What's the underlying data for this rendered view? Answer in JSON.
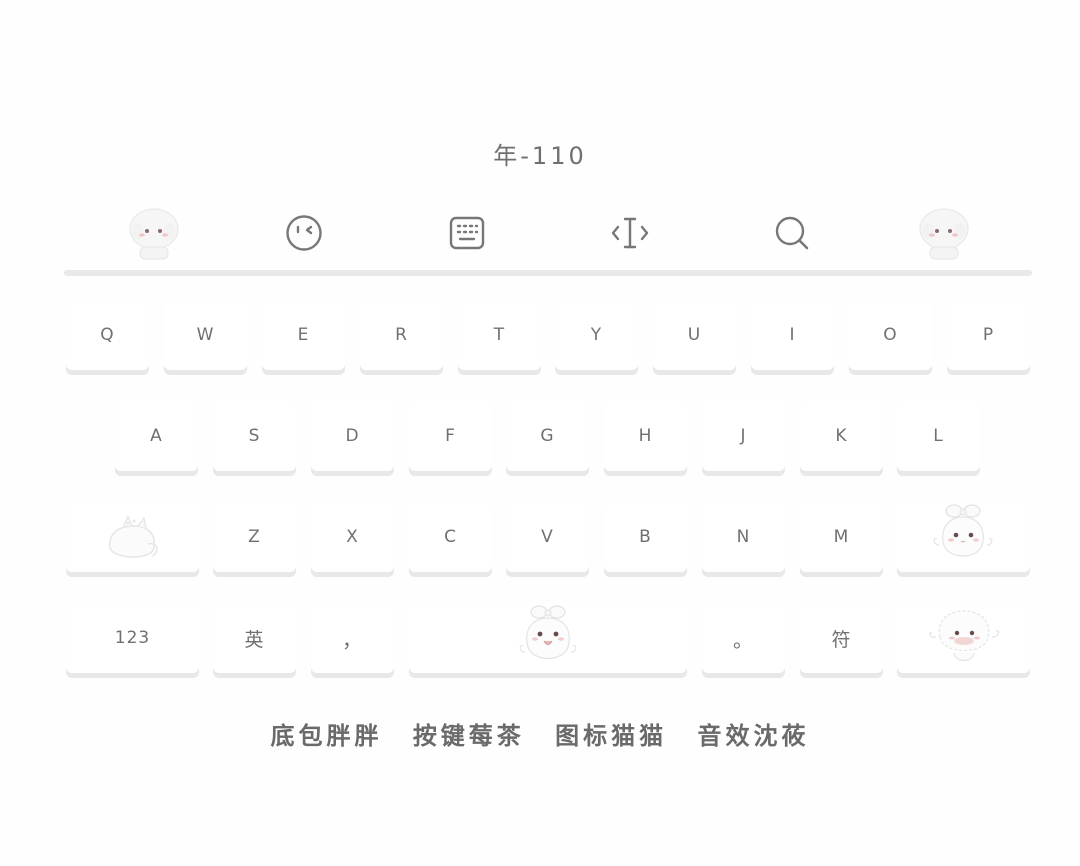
{
  "header": {
    "title": "年-110"
  },
  "toolbar": {
    "items": [
      {
        "name": "mascot-left-icon"
      },
      {
        "name": "emoji-icon"
      },
      {
        "name": "keyboard-icon"
      },
      {
        "name": "cursor-move-icon"
      },
      {
        "name": "search-icon"
      },
      {
        "name": "mascot-right-icon"
      }
    ]
  },
  "keyboard": {
    "row1": [
      "Q",
      "W",
      "E",
      "R",
      "T",
      "Y",
      "U",
      "I",
      "O",
      "P"
    ],
    "row2": [
      "A",
      "S",
      "D",
      "F",
      "G",
      "H",
      "J",
      "K",
      "L"
    ],
    "row3": [
      "Z",
      "X",
      "C",
      "V",
      "B",
      "N",
      "M"
    ],
    "row4": {
      "numbers_label": "123",
      "lang_label": "英",
      "comma_label": "，",
      "period_label": "。",
      "symbol_label": "符"
    },
    "shift_icon": "cat-sleeping-icon",
    "delete_icon": "bunny-bow-icon",
    "space_icon": "bunny-space-icon",
    "enter_icon": "fluffy-cat-icon"
  },
  "footer": {
    "items": [
      "底包胖胖",
      "按键莓茶",
      "图标猫猫",
      "音效沈莜"
    ]
  },
  "colors": {
    "background": "#fefefe",
    "key": "#ffffff",
    "key_shadow": "#e8e8e8",
    "text": "#707070"
  }
}
